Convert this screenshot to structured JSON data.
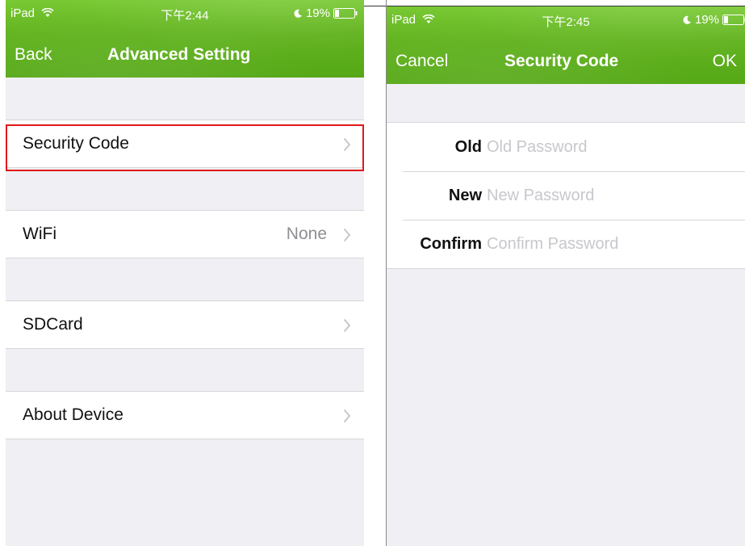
{
  "left_screen": {
    "status": {
      "carrier": "iPad",
      "time": "下午2:44",
      "battery": "19%"
    },
    "nav": {
      "back_label": "Back",
      "title": "Advanced Setting"
    },
    "items": [
      {
        "label": "Security Code",
        "detail": ""
      },
      {
        "label": "WiFi",
        "detail": "None"
      },
      {
        "label": "SDCard",
        "detail": ""
      },
      {
        "label": "About Device",
        "detail": ""
      }
    ]
  },
  "right_screen": {
    "status": {
      "carrier": "iPad",
      "time": "下午2:45",
      "battery": "19%"
    },
    "nav": {
      "cancel_label": "Cancel",
      "title": "Security Code",
      "ok_label": "OK"
    },
    "fields": [
      {
        "label": "Old",
        "placeholder": "Old Password",
        "value": ""
      },
      {
        "label": "New",
        "placeholder": "New Password",
        "value": ""
      },
      {
        "label": "Confirm",
        "placeholder": "Confirm Password",
        "value": ""
      }
    ]
  },
  "colors": {
    "nav_green": "#62b320",
    "highlight_red": "#e01818",
    "background": "#efeff4"
  }
}
